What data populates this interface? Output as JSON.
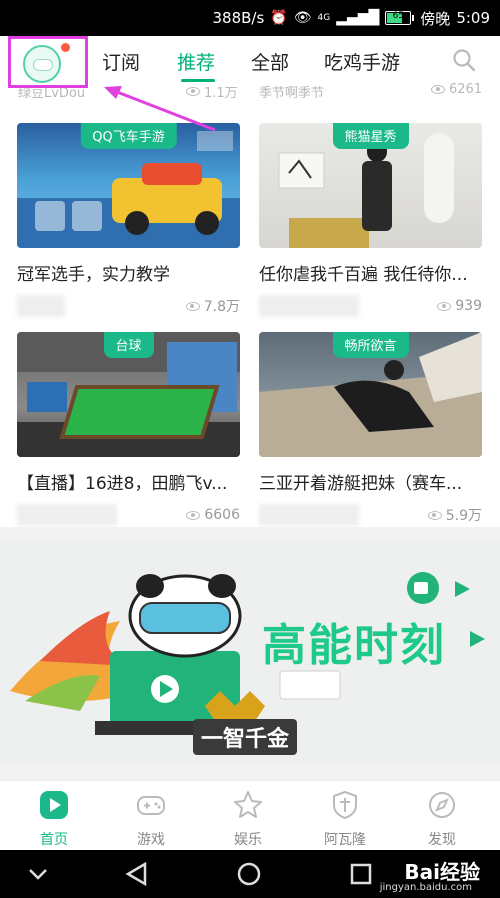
{
  "status_bar": {
    "speed": "388B/s",
    "network": "4G",
    "battery": "65",
    "carrier": "傍晚",
    "time": "5:09"
  },
  "top_nav": {
    "tabs": [
      {
        "label": "订阅",
        "active": false
      },
      {
        "label": "推荐",
        "active": true
      },
      {
        "label": "全部",
        "active": false
      },
      {
        "label": "吃鸡手游",
        "active": false
      }
    ]
  },
  "partial_row": {
    "left_text": "绿豆LvDou",
    "left_views": "1.1万",
    "right_text": "季节啊季节",
    "right_views": "6261"
  },
  "cards": [
    {
      "tag": "QQ飞车手游",
      "title": "冠军选手，实力教学",
      "views": "7.8万"
    },
    {
      "tag": "熊猫星秀",
      "title": "任你虐我千百遍 我任待你...",
      "views": "939"
    },
    {
      "tag": "台球",
      "title": "【直播】16进8，田鹏飞v...",
      "views": "6606"
    },
    {
      "tag": "畅所欲言",
      "title": "三亚开着游艇把妹（赛车...",
      "views": "5.9万"
    }
  ],
  "banner": {
    "title": "高能时刻",
    "badge": "一智千金"
  },
  "bottom_nav": {
    "items": [
      {
        "label": "首页",
        "icon": "home-play-icon",
        "active": true
      },
      {
        "label": "游戏",
        "icon": "gamepad-icon",
        "active": false
      },
      {
        "label": "娱乐",
        "icon": "star-icon",
        "active": false
      },
      {
        "label": "阿瓦隆",
        "icon": "shield-icon",
        "active": false
      },
      {
        "label": "发现",
        "icon": "compass-icon",
        "active": false
      }
    ]
  },
  "watermark": {
    "brand": "Bai经验",
    "url": "jingyan.baidu.com"
  },
  "colors": {
    "accent": "#1bb889",
    "highlight": "#e040e0"
  }
}
